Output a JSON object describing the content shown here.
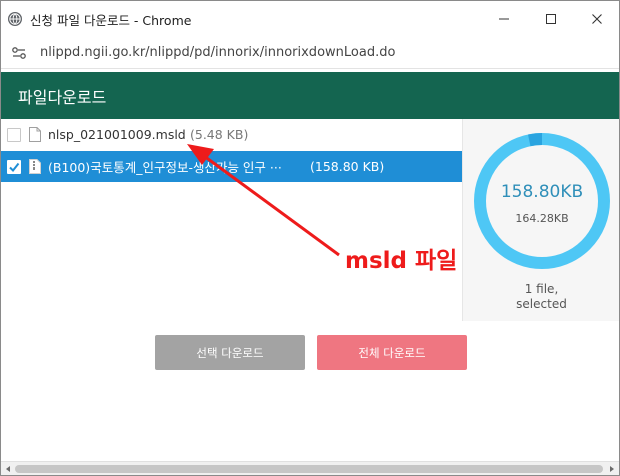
{
  "window": {
    "title": "신청 파일 다운로드 - Chrome",
    "app_icon": "chrome-globe-icon",
    "controls": [
      "minimize-icon",
      "maximize-icon",
      "close-icon"
    ]
  },
  "urlbar": {
    "site_icon": "site-settings-icon",
    "url": "nlippd.ngii.go.kr/nlippd/pd/innorix/innorixdownLoad.do"
  },
  "header": {
    "title": "파일다운로드"
  },
  "files": [
    {
      "name": "nlsp_021001009.msld",
      "size": "(5.48 KB)",
      "checked": false,
      "selected": false
    },
    {
      "name": "(B100)국토통계_인구정보-생산가능 인구 ···",
      "size": "(158.80 KB)",
      "checked": true,
      "selected": true
    }
  ],
  "summary": {
    "total": "158.80KB",
    "partial": "164.28KB",
    "caption_line1": "1 file,",
    "caption_line2": "selected",
    "fill_fraction": 0.967
  },
  "buttons": {
    "select_download": "선택 다운로드",
    "all_download": "전체 다운로드"
  },
  "annotation": {
    "text": "msld 파일"
  },
  "colors": {
    "header_bg": "#146550",
    "selected_row": "#1f8ed6",
    "donut_ring": "#4ec7f5",
    "donut_small_segment": "#2aa4e0",
    "select_button": "#a3a3a3",
    "all_button": "#ef7681",
    "annotation": "#ee1b1b"
  }
}
